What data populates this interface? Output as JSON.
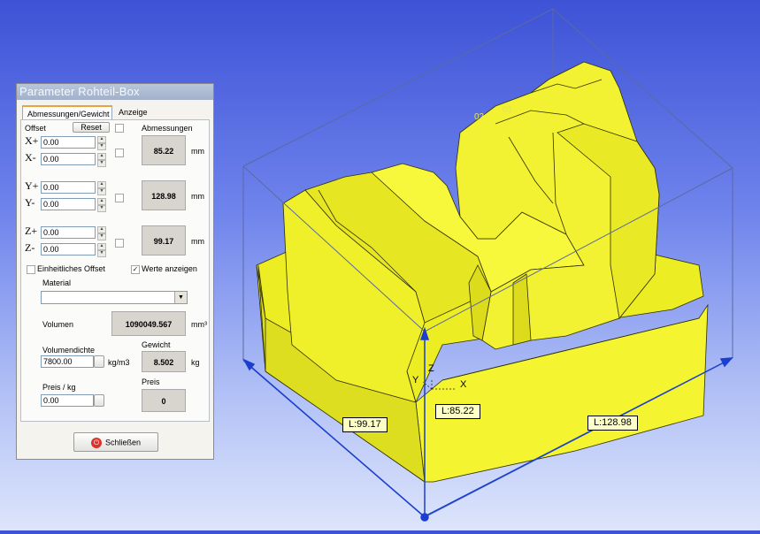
{
  "viewport": {
    "dimension_labels": {
      "z": "L:99.17",
      "x": "L:85.22",
      "y": "L:128.98"
    },
    "axis_labels": {
      "x": "X",
      "y": "Y",
      "z": "Z"
    },
    "corner_labels": [
      "02",
      "01"
    ],
    "colors": {
      "part": "#ffff3a",
      "edge": "#303000",
      "box": "#5a6aa0",
      "arrow": "#1a3fd0"
    }
  },
  "dialog": {
    "title": "Parameter Rohteil-Box",
    "tabs": [
      {
        "label": "Abmessungen/Gewicht"
      },
      {
        "label": "Anzeige"
      }
    ],
    "offset_label": "Offset",
    "reset_label": "Reset",
    "dimensions_label": "Abmessungen",
    "fields": {
      "x_plus": {
        "axis": "X+",
        "value": "0.00"
      },
      "x_minus": {
        "axis": "X-",
        "value": "0.00"
      },
      "y_plus": {
        "axis": "Y+",
        "value": "0.00"
      },
      "y_minus": {
        "axis": "Y-",
        "value": "0.00"
      },
      "z_plus": {
        "axis": "Z+",
        "value": "0.00"
      },
      "z_minus": {
        "axis": "Z-",
        "value": "0.00"
      }
    },
    "dimensions": {
      "x": "85.22",
      "y": "128.98",
      "z": "99.17",
      "unit": "mm"
    },
    "uniform_offset_label": "Einheitliches Offset",
    "show_values_label": "Werte anzeigen",
    "show_values_checked": true,
    "material_label": "Material",
    "material_value": "",
    "volume_label": "Volumen",
    "volume_value": "1090049.567",
    "volume_unit": "mm³",
    "density_label": "Volumendichte",
    "density_value": "7800.00",
    "density_unit": "kg/m3",
    "weight_label": "Gewicht",
    "weight_value": "8.502",
    "weight_unit": "kg",
    "price_label": "Preis / kg",
    "price_value": "0.00",
    "price_total_label": "Preis",
    "price_total_value": "0",
    "close_label": "Schließen"
  }
}
